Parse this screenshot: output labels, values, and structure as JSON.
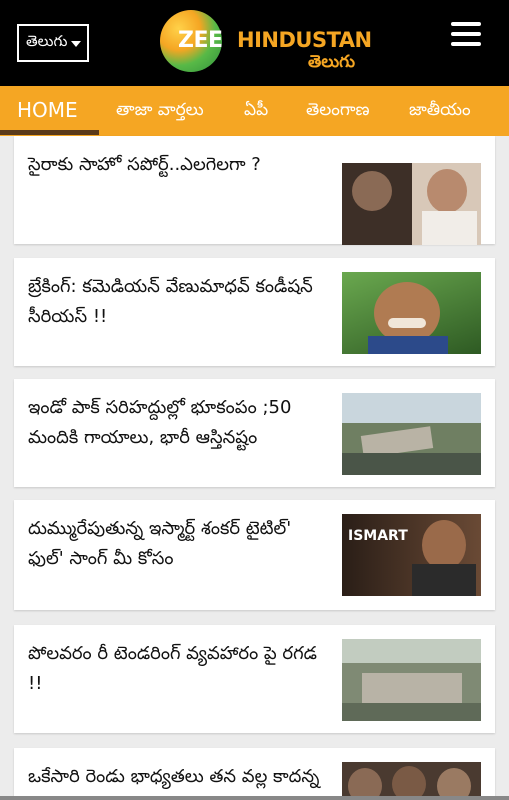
{
  "header": {
    "language_select": "తెలుగు",
    "logo": {
      "brand_zee": "ZEE",
      "brand_hindustan": "HINDUSTAN",
      "brand_sub": "తెలుగు"
    }
  },
  "nav": {
    "items": [
      {
        "label": "HOME"
      },
      {
        "label": "తాజా వార్తలు"
      },
      {
        "label": "ఏపీ"
      },
      {
        "label": "తెలంగాణ"
      },
      {
        "label": "జాతీయం"
      }
    ]
  },
  "articles": [
    {
      "title": "సైరాకు సాహో సపోర్ట్..ఎలగెలగా ?"
    },
    {
      "title": "బ్రేకింగ్: కమెడియన్ వేణుమాధవ్ కండీషన్ సీరియస్ !!"
    },
    {
      "title": "ఇండో పాక్ సరిహద్దుల్లో భూకంపం ;50 మందికి గాయాలు, భారీ ఆస్తినష్టం"
    },
    {
      "title": "దుమ్మురేపుతున్న ఇస్మార్ట్ శంకర్ టైటిల్' ఫుల్' సాంగ్ మీ కోసం"
    },
    {
      "title": "పోలవరం రీ టెండరింగ్ వ్యవహారం పై రగడ !!"
    },
    {
      "title": "ఒకేసారి రెండు భాధ్యతలు తన వల్ల కాదన్న"
    }
  ],
  "thumb4_text": "ISMART"
}
